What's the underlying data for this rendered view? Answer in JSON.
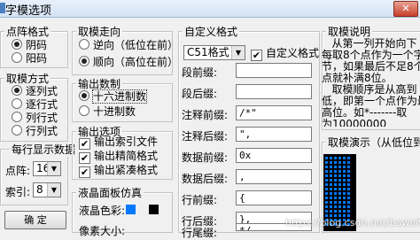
{
  "window": {
    "title": "字模选项",
    "close_label": "✕"
  },
  "dot_format": {
    "title": "点阵格式",
    "options": [
      "阴码",
      "阳码"
    ],
    "selected": 0
  },
  "mode": {
    "title": "取模方式",
    "options": [
      "逐列式",
      "逐行式",
      "列行式",
      "行列式"
    ],
    "selected": 0
  },
  "display": {
    "title": "每行显示数据",
    "dot_label": "点阵:",
    "dot_value": "16",
    "index_label": "索引:",
    "index_value": "8",
    "ok_label": "确  定"
  },
  "direction": {
    "title": "取模走向",
    "options": [
      "逆向（低位在前）",
      "顺向（高位在前）"
    ],
    "selected": 1
  },
  "output_base": {
    "title": "输出数制",
    "options": [
      "十六进制数",
      "十进制数"
    ],
    "selected": 0
  },
  "output_options": {
    "title": "输出选项",
    "items": [
      "输出索引文件",
      "输出精简格式",
      "输出紧凑格式"
    ],
    "checked": [
      true,
      true,
      true
    ]
  },
  "lcd": {
    "title": "液晶面板仿真",
    "color_label": "液晶色彩:",
    "size_label": "像素大小:",
    "color_on": "#0078ff",
    "color_off": "#000000"
  },
  "custom": {
    "title": "自定义格式",
    "format_value": "C51格式",
    "custom_checkbox": "自定义格式",
    "fields": [
      {
        "label": "段前缀:",
        "value": ""
      },
      {
        "label": "段后缀:",
        "value": ""
      },
      {
        "label": "注释前缀:",
        "value": "/*\""
      },
      {
        "label": "注释后缀:",
        "value": "\","
      },
      {
        "label": "数据前缀:",
        "value": "0x"
      },
      {
        "label": "数据后缀:",
        "value": ","
      },
      {
        "label": "行前缀:",
        "value": "{"
      },
      {
        "label": "行后缀:",
        "value": "},"
      },
      {
        "label": "行尾缀:",
        "value": "*/"
      }
    ]
  },
  "help": {
    "title": "取模说明",
    "text": "   从第一列开始向下\n每取8个点作为一个字\n节，如果最后不足8个\n点就补满8位。\n   取模顺序是从高到\n低，即第一个点作为最\n高位。如*-------取\n为10000000",
    "preview_title": "取模演示（从低位到高"
  },
  "watermark": "https://blog.csdn.net/bawei939"
}
